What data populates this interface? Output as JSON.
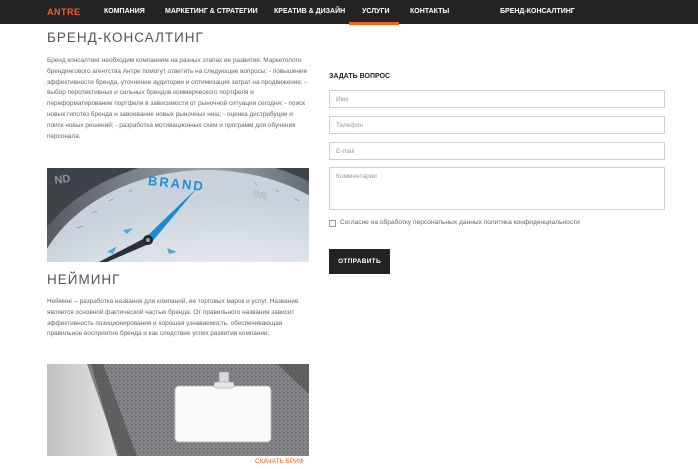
{
  "nav": {
    "logo": "ANTRE",
    "items": [
      {
        "label": "КОМПАНИЯ"
      },
      {
        "label": "МАРКЕТИНГ & СТРАТЕГИИ"
      },
      {
        "label": "КРЕАТИВ & ДИЗАЙН"
      },
      {
        "label": "УСЛУГИ"
      },
      {
        "label": "КОНТАКТЫ"
      },
      {
        "label": "БРЕНД-КОНСАЛТИНГ"
      }
    ],
    "active_index": 3,
    "accent_color": "#f2611e",
    "bar_color": "#232323"
  },
  "sections": {
    "consulting": {
      "title": "БРЕНД-КОНСАЛТИНГ",
      "text": "Бренд консалтинг необходим компаниям на разных этапах ее развития. Маркетологи брендингового агентства Антре помогут ответить на следующие вопросы: - повышение эффективности бренда, уточнение аудитории и оптимизация затрат на продвижение; - выбор перспективных и сильных брендов коммерческого портфеля и переформатирование портфеля в зависимости от рыночной ситуации сегодня; - поиск новых гипотез бренда и завоевание новых рыночных ниш; - оценка дистрибуции и поиск новых решений; - разработка мотивационных схем и программ для обучения персонала.",
      "image": {
        "icon": "brand-compass-image",
        "word": "BRAND"
      }
    },
    "naming": {
      "title": "НЕЙМИНГ",
      "text": "Нейминг – разработка названия для компаний, ее торговых марок и услуг. Название является основной фактической частью бренда. От правильного названия зависит эффективность позиционирования и хорошая узнаваемость, обеспечивающая правильное восприятие бренда и как следствие успех развития компании.",
      "image": {
        "icon": "name-badge-image"
      }
    }
  },
  "form": {
    "title": "ЗАДАТЬ ВОПРОС",
    "name_placeholder": "Имя",
    "phone_placeholder": "Телефон",
    "email_placeholder": "E-mail",
    "comment_placeholder": "Комментарии",
    "consent_label": "Согласие на обработку персональных данных политика конфиденциальности",
    "consent_checked": false,
    "submit_label": "ОТПРАВИТЬ"
  },
  "download_link": "СКАЧАТЬ БРИФ"
}
